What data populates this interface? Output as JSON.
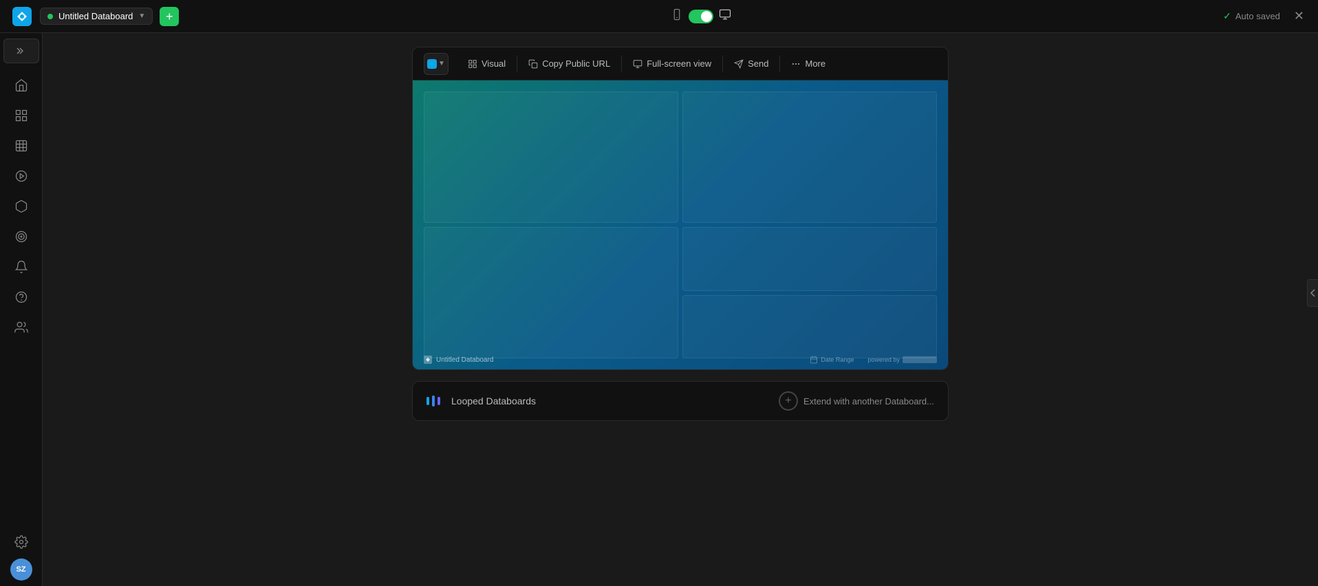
{
  "topbar": {
    "title": "Untitled Databoard",
    "title_dot_color": "#22c55e",
    "add_btn_label": "+",
    "auto_saved_label": "Auto saved",
    "close_label": "✕"
  },
  "toolbar": {
    "visual_label": "Visual",
    "copy_url_label": "Copy Public URL",
    "fullscreen_label": "Full-screen view",
    "send_label": "Send",
    "more_label": "More"
  },
  "preview": {
    "databoard_name": "Untitled Databoard",
    "date_range_label": "Date Range",
    "powered_by": "powered by"
  },
  "looped": {
    "label": "Looped Databoards",
    "extend_label": "Extend with another Databoard..."
  },
  "sidebar": {
    "items": [
      {
        "name": "home",
        "icon": "home"
      },
      {
        "name": "grid",
        "icon": "grid"
      },
      {
        "name": "chart",
        "icon": "chart"
      },
      {
        "name": "play",
        "icon": "play"
      },
      {
        "name": "package",
        "icon": "package"
      },
      {
        "name": "target",
        "icon": "target"
      },
      {
        "name": "bell",
        "icon": "bell"
      },
      {
        "name": "help",
        "icon": "help"
      },
      {
        "name": "team",
        "icon": "team"
      }
    ],
    "settings_label": "settings",
    "avatar_initials": "SZ"
  }
}
